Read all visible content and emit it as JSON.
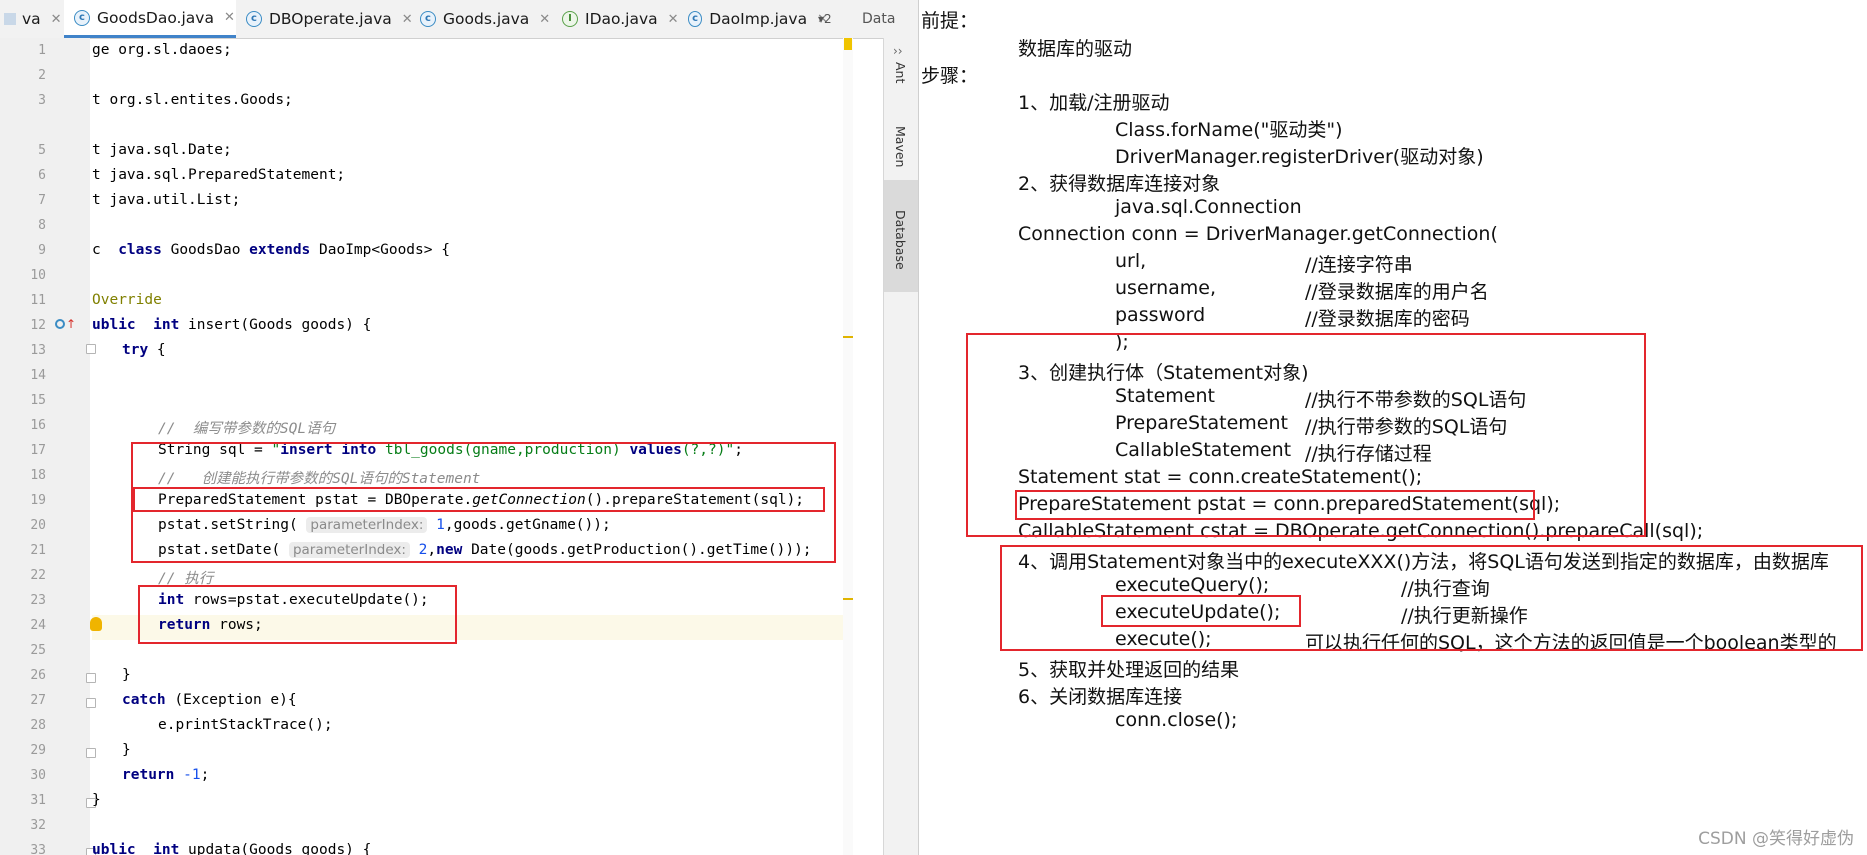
{
  "tabs": [
    {
      "label": "va",
      "icon": "java-class-icon"
    },
    {
      "label": "GoodsDao.java",
      "icon": "java-class-icon"
    },
    {
      "label": "DBOperate.java",
      "icon": "java-class-icon"
    },
    {
      "label": "Goods.java",
      "icon": "java-class-icon"
    },
    {
      "label": "IDao.java",
      "icon": "java-interface-icon"
    },
    {
      "label": "DaoImp.java",
      "icon": "java-class-icon"
    }
  ],
  "tab_overflow": "▾2",
  "tab_extra": "Data",
  "side_panels": [
    "Ant",
    "Maven",
    "Database"
  ],
  "line_numbers": [
    "1",
    "2",
    "3",
    "5",
    "6",
    "7",
    "8",
    "9",
    "10",
    "11",
    "12",
    "13",
    "14",
    "15",
    "16",
    "17",
    "18",
    "19",
    "20",
    "21",
    "22",
    "23",
    "24",
    "25",
    "26",
    "27",
    "28",
    "29",
    "30",
    "31",
    "32",
    "33"
  ],
  "code": {
    "l1": "ge org.sl.daoes;",
    "l3": "t org.sl.entites.Goods;",
    "l5": "t java.sql.Date;",
    "l6": "t java.sql.PreparedStatement;",
    "l7": "t java.util.List;",
    "l9a": "c  ",
    "l9b": "class",
    "l9c": " GoodsDao ",
    "l9d": "extends",
    "l9e": " DaoImp<Goods> {",
    "l11": "Override",
    "l12a": "ublic  ",
    "l12b": "int",
    "l12c": " insert(Goods goods) {",
    "l13": "try",
    "l13b": " {",
    "l16": "//  编写带参数的SQL语句",
    "l17a": "String sql = ",
    "l17b": "\"",
    "l17c": "insert into",
    "l17d": " tbl_goods(gname,production) ",
    "l17e": "values",
    "l17f": "(?,?)\"",
    "l17g": ";",
    "l18": "//   创建能执行带参数的SQL语句的Statement",
    "l19a": "PreparedStatement pstat = DBOperate.",
    "l19b": "getConnection",
    "l19c": "().prepareStatement(sql);",
    "l20a": "pstat.setString( ",
    "l20h": "parameterIndex:",
    "l20b": " 1",
    "l20c": ",goods.getGname());",
    "l21a": "pstat.setDate( ",
    "l21h": "parameterIndex:",
    "l21b": " 2",
    "l21c": ",",
    "l21d": "new",
    "l21e": " Date(goods.getProduction().getTime()));",
    "l22": "// 执行",
    "l23a": "int",
    "l23b": " rows=pstat.executeUpdate();",
    "l24a": "return",
    "l24b": " rows;",
    "l26": "}",
    "l27a": "catch",
    "l27b": " (Exception e){",
    "l28": "e.printStackTrace();",
    "l29": "}",
    "l30a": "return",
    "l30b": " -1",
    "l30c": ";",
    "l31": "}",
    "l33a": "ublic  ",
    "l33b": "int",
    "l33c": " updata(Goods goods) {"
  },
  "notes": [
    "前提：",
    "数据库的驱动",
    "步骤：",
    "1、加载/注册驱动",
    "Class.forName(\"驱动类\")",
    "DriverManager.registerDriver(驱动对象)",
    "2、获得数据库连接对象",
    "java.sql.Connection",
    "Connection conn = DriverManager.getConnection(",
    "url,",
    "//连接字符串",
    "username,",
    "//登录数据库的用户名",
    "password",
    "//登录数据库的密码",
    ");",
    "3、创建执行体（Statement对象)",
    "Statement",
    "//执行不带参数的SQL语句",
    "PrepareStatement",
    "//执行带参数的SQL语句",
    "CallableStatement",
    "//执行存储过程",
    "Statement stat = conn.createStatement();",
    "PrepareStatement pstat = conn.preparedStatement(sql);",
    "CallableStatement cstat = DBOperate.getConnection().prepareCall(sql);",
    "4、调用Statement对象当中的executeXXX()方法，将SQL语句发送到指定的数据库，由数据库",
    "executeQuery();",
    "//执行查询",
    "executeUpdate();",
    "//执行更新操作",
    "execute();",
    "可以执行任何的SQL，这个方法的返回值是一个boolean类型的",
    "5、获取并处理返回的结果",
    "6、关闭数据库连接",
    "conn.close();"
  ],
  "watermark": "CSDN @笑得好虚伪",
  "colors": {
    "accent": "#4083c9",
    "highlight_box": "#e3262d",
    "keyword": "#000080",
    "string": "#067d17",
    "comment": "#8c8c8c"
  }
}
